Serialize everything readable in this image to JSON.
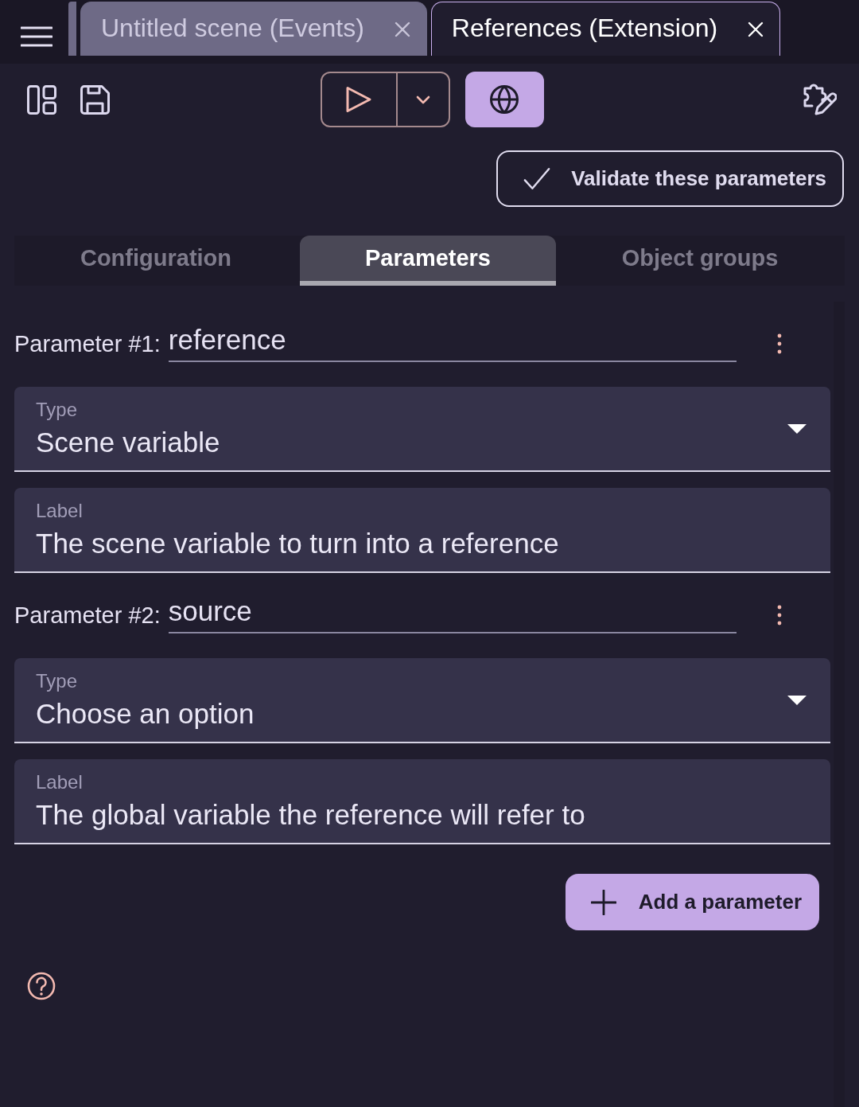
{
  "editor_tabs": [
    {
      "label": "Untitled scene (Events)",
      "selected": false
    },
    {
      "label": "References (Extension)",
      "selected": true
    }
  ],
  "validate_button": {
    "label": "Validate these parameters"
  },
  "section_tabs": [
    {
      "label": "Configuration",
      "selected": false
    },
    {
      "label": "Parameters",
      "selected": true
    },
    {
      "label": "Object groups",
      "selected": false
    }
  ],
  "parameters": [
    {
      "heading": "Parameter #1:",
      "name": "reference",
      "type_field": {
        "label": "Type",
        "value": "Scene variable"
      },
      "label_field": {
        "label": "Label",
        "value": "The scene variable to turn into a reference"
      }
    },
    {
      "heading": "Parameter #2:",
      "name": "source",
      "type_field": {
        "label": "Type",
        "value": "Choose an option"
      },
      "label_field": {
        "label": "Label",
        "value": "The global variable the reference will refer to"
      }
    }
  ],
  "add_button": {
    "label": "Add a parameter"
  }
}
